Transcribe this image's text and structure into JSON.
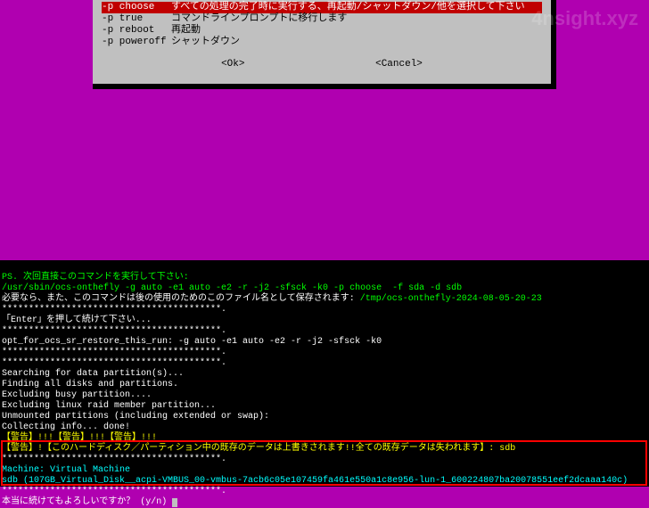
{
  "watermark": "4nsight.xyz",
  "dialog": {
    "options": [
      {
        "key": "-p choose",
        "desc": "すべての処理の完了時に実行する、再起動/シャットダウン/他を選択して下さい",
        "selected": true
      },
      {
        "key": "-p true",
        "desc": "コマンドラインプロンプトに移行します",
        "selected": false
      },
      {
        "key": "-p reboot",
        "desc": "再起動",
        "selected": false
      },
      {
        "key": "-p poweroff",
        "desc": "シャットダウン",
        "selected": false
      }
    ],
    "ok": "<Ok>",
    "cancel": "<Cancel>"
  },
  "terminal": {
    "line1": "PS. 次回直接このコマンドを実行して下さい:",
    "line2": "/usr/sbin/ocs-onthefly -g auto -e1 auto -e2 -r -j2 -sfsck -k0 -p choose  -f sda -d sdb",
    "line3a": "必要なら、また、このコマンドは後の使用のためのこのファイル名として保存されます: ",
    "line3b": "/tmp/ocs-onthefly-2024-08-05-20-23",
    "stars1": "*****************************************.",
    "line4": "「Enter」を押して続けて下さい...",
    "stars2": "*****************************************.",
    "line5": "opt_for_ocs_sr_restore_this_run: -g auto -e1 auto -e2 -r -j2 -sfsck -k0",
    "stars3": "*****************************************.",
    "stars4": "*****************************************.",
    "line6": "Searching for data partition(s)...",
    "line7": "Finding all disks and partitions.",
    "line8": "Excluding busy partition....",
    "line9": "Excluding linux raid member partition...",
    "line10": "Unmounted partitions (including extended or swap):",
    "line11": "Collecting info... done!",
    "warn1": "【警告】!!!【警告】!!!【警告】!!!",
    "warn2": "【警告】!【このハードディスク／パーティション中の既存のデータは上書きされます!!全ての既存データは失われます】: sdb",
    "stars5": "*****************************************.",
    "machine": "Machine: Virtual Machine",
    "sdb": "sdb (107GB_Virtual_Disk__acpi-VMBUS_00-vmbus-7acb6c05e107459fa461e550a1c8e956-lun-1_600224807ba20078551eef2dcaaa140c)",
    "stars6": "*****************************************.",
    "prompt": "本当に続けてもよろしいですか？ (y/n) "
  }
}
